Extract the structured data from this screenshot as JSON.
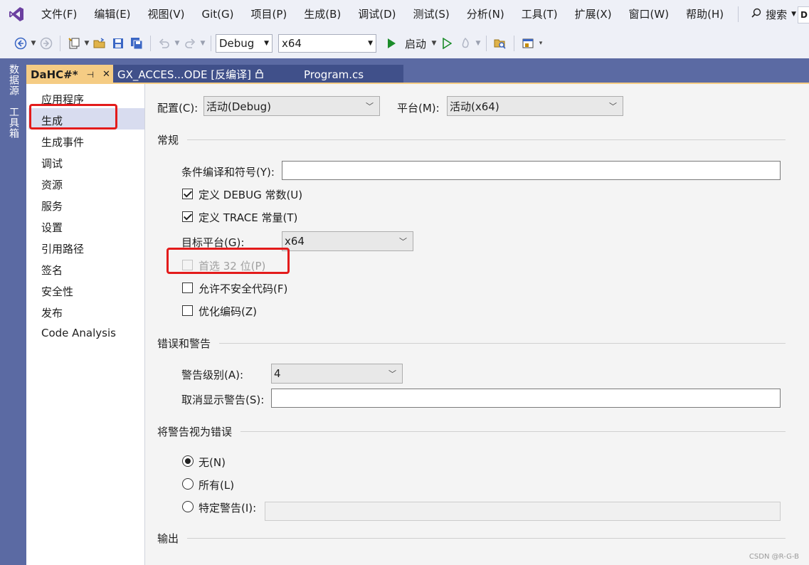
{
  "menu": {
    "items": [
      "文件(F)",
      "编辑(E)",
      "视图(V)",
      "Git(G)",
      "项目(P)",
      "生成(B)",
      "调试(D)",
      "测试(S)",
      "分析(N)",
      "工具(T)",
      "扩展(X)",
      "窗口(W)",
      "帮助(H)"
    ],
    "search_label": "搜索",
    "user_initial": "D"
  },
  "toolbar": {
    "config_value": "Debug",
    "platform_value": "x64",
    "start_label": "启动"
  },
  "side_strip": {
    "item1": "数据源",
    "item2": "工具箱"
  },
  "tabs": [
    {
      "label": "DaHC#*"
    },
    {
      "label": "GX_ACCES...ODE [反编译]"
    },
    {
      "label": "Program.cs"
    }
  ],
  "nav": {
    "items": [
      "应用程序",
      "生成",
      "生成事件",
      "调试",
      "资源",
      "服务",
      "设置",
      "引用路径",
      "签名",
      "安全性",
      "发布",
      "Code Analysis"
    ],
    "selected": "生成"
  },
  "main": {
    "config_label": "配置(C):",
    "config_value": "活动(Debug)",
    "platform_label": "平台(M):",
    "platform_value": "活动(x64)",
    "section_general": "常规",
    "conditional_symbols_label": "条件编译和符号(Y):",
    "conditional_symbols_value": "",
    "define_debug_label": "定义 DEBUG 常数(U)",
    "define_debug_checked": true,
    "define_trace_label": "定义 TRACE 常量(T)",
    "define_trace_checked": true,
    "target_platform_label": "目标平台(G):",
    "target_platform_value": "x64",
    "prefer32_label": "首选 32 位(P)",
    "prefer32_checked": false,
    "prefer32_enabled": false,
    "unsafe_label": "允许不安全代码(F)",
    "unsafe_checked": false,
    "optimize_label": "优化编码(Z)",
    "optimize_checked": false,
    "section_errors": "错误和警告",
    "warning_level_label": "警告级别(A):",
    "warning_level_value": "4",
    "suppress_label": "取消显示警告(S):",
    "suppress_value": "",
    "section_treat": "将警告视为错误",
    "radio_none_label": "无(N)",
    "radio_all_label": "所有(L)",
    "radio_specific_label": "特定警告(I):",
    "radio_selected": "none",
    "section_output": "输出"
  },
  "watermark": "CSDN @R-G-B",
  "colors": {
    "accent_tab": "#f5cc84",
    "strip": "#5b6aa3",
    "annotation_red": "#e31b1b",
    "vs_purple": "#6b3fa0"
  }
}
